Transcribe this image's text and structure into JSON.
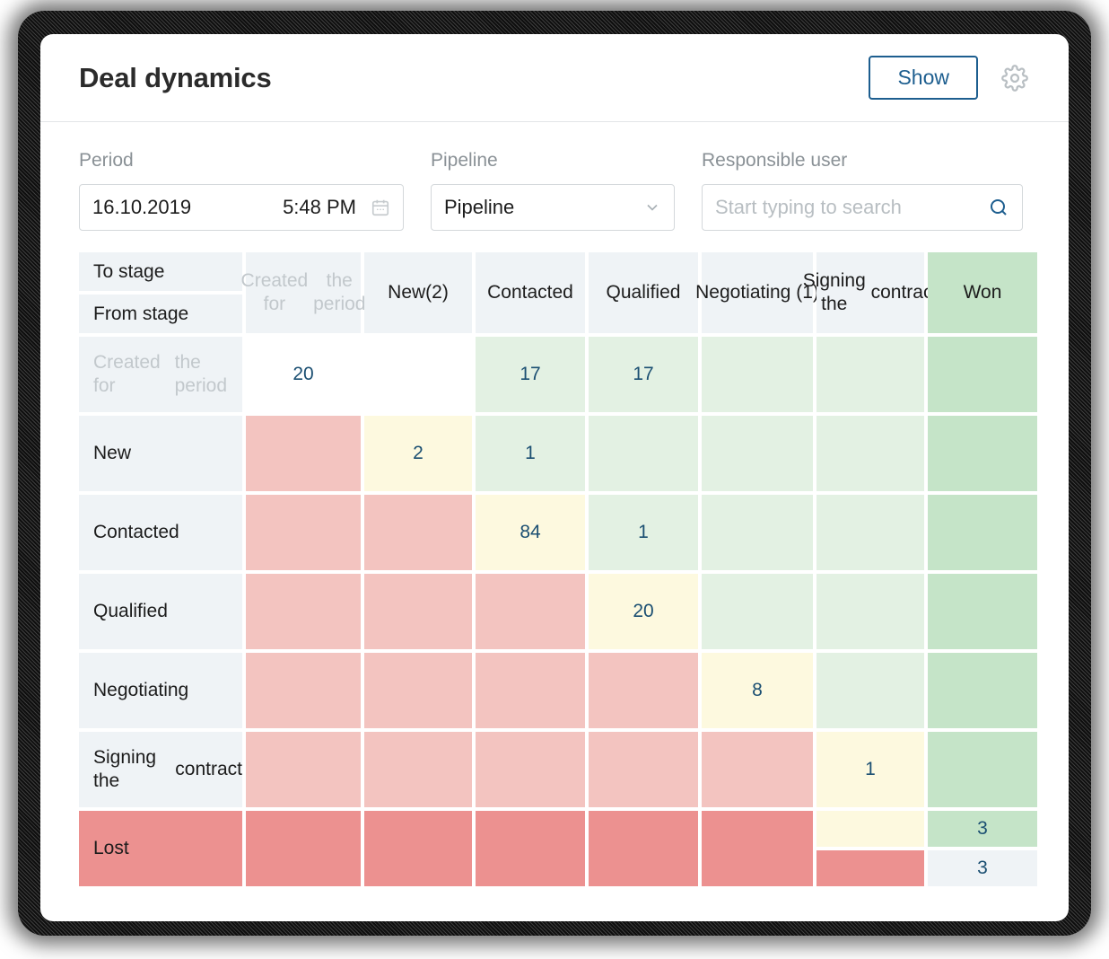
{
  "header": {
    "title": "Deal dynamics",
    "show_label": "Show",
    "gear_icon": "gear-icon"
  },
  "filters": {
    "period": {
      "label": "Period",
      "date": "16.10.2019",
      "time": "5:48 PM",
      "icon": "calendar-icon"
    },
    "pipeline": {
      "label": "Pipeline",
      "value": "Pipeline",
      "icon": "chevron-down-icon"
    },
    "responsible_user": {
      "label": "Responsible user",
      "value": "",
      "placeholder": "Start typing to search",
      "icon": "search-icon"
    }
  },
  "matrix": {
    "corner": {
      "to_stage": "To stage",
      "from_stage": "From stage"
    },
    "columns": [
      "Created for the period",
      "New(2)",
      "Contacted",
      "Qualified",
      "Negotiating (1)",
      "Signing the contract",
      "Won"
    ],
    "col_created": "Created for",
    "col_created2": "the period",
    "col_new": "New(2)",
    "col_contacted": "Contacted",
    "col_qualified": "Qualified",
    "col_negotiating": "Negotiating",
    "col_negotiating2": "(1)",
    "col_signing": "Signing the",
    "col_signing2": "contract",
    "col_won": "Won",
    "rows": [
      {
        "label": "Created for the period",
        "label1": "Created for",
        "label2": "the period",
        "values": [
          "20",
          "",
          "17",
          "17",
          "",
          "",
          ""
        ]
      },
      {
        "label": "New",
        "label1": "New",
        "label2": "",
        "values": [
          "",
          "2",
          "1",
          "",
          "",
          "",
          ""
        ]
      },
      {
        "label": "Contacted",
        "label1": "Contacted",
        "label2": "",
        "values": [
          "",
          "",
          "84",
          "1",
          "",
          "",
          ""
        ]
      },
      {
        "label": "Qualified",
        "label1": "Qualified",
        "label2": "",
        "values": [
          "",
          "",
          "",
          "20",
          "",
          "",
          ""
        ]
      },
      {
        "label": "Negotiating",
        "label1": "Negotiating",
        "label2": "",
        "values": [
          "",
          "",
          "",
          "",
          "8",
          "",
          ""
        ]
      },
      {
        "label": "Signing the contract",
        "label1": "Signing the",
        "label2": "contract",
        "values": [
          "",
          "",
          "",
          "",
          "",
          "1",
          ""
        ]
      },
      {
        "label": "Lost",
        "label1": "Lost",
        "label2": "",
        "values": [
          "",
          "",
          "",
          "",
          "",
          "",
          ""
        ],
        "won_top": "3",
        "won_bottom": "3"
      }
    ]
  },
  "colors": {
    "accent_blue": "#1d5e8f",
    "value_blue": "#1b4f72",
    "header_bg": "#eff3f6",
    "green_light": "#e3f1e3",
    "green_won": "#c5e4c8",
    "cream": "#fdf9df",
    "pink": "#f3c4c0",
    "pink_deep": "#ec9190"
  }
}
